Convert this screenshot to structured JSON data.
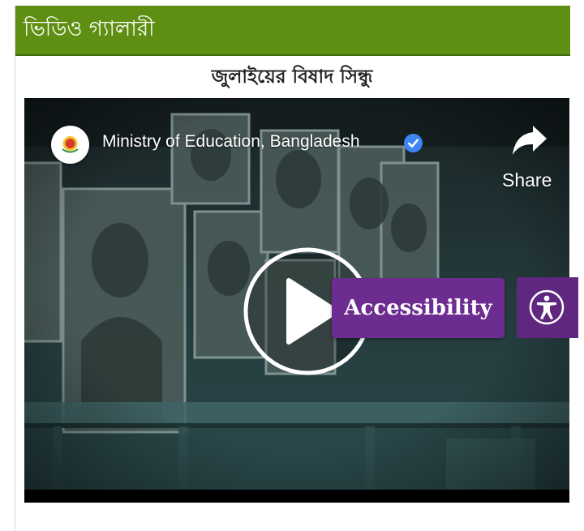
{
  "widget": {
    "title": "ভিডিও গ্যালারী"
  },
  "video": {
    "title": "জুলাইয়ের বিষাদ সিন্ধু",
    "channel_name": "Ministry of Education, Bangladesh",
    "share_label": "Share",
    "icons": {
      "channel": "government-seal-icon",
      "verified": "verified-check-icon",
      "share": "share-arrow-icon",
      "play": "play-icon"
    }
  },
  "accessibility": {
    "label": "Accessibility",
    "icon": "accessibility-person-icon"
  },
  "colors": {
    "header_bg": "#5e8f12",
    "accessibility_purple": "#6d2c8f",
    "verified_blue": "#3f85f4"
  }
}
